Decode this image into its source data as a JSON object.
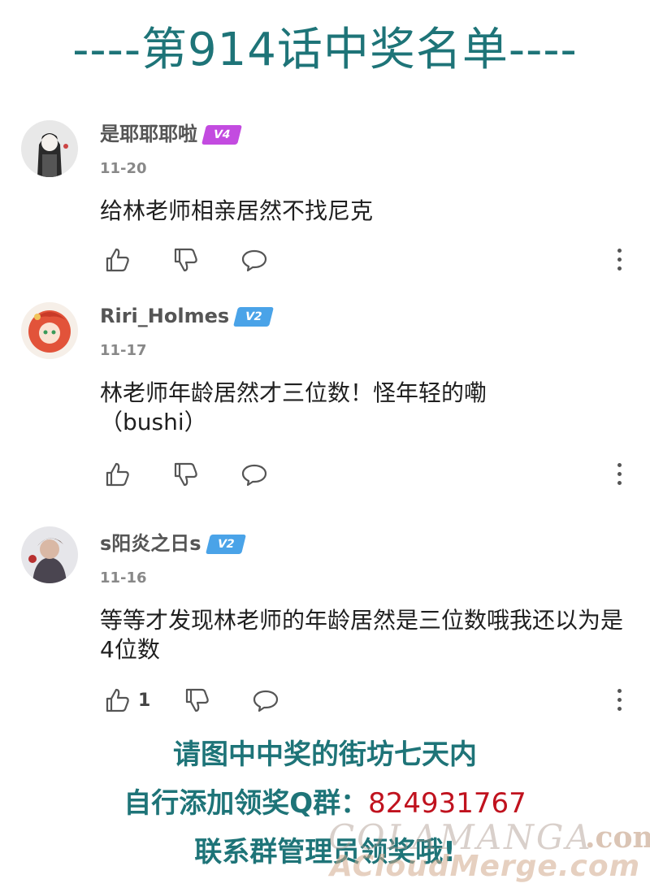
{
  "header": {
    "title": "----第914话中奖名单----"
  },
  "comments": [
    {
      "username": "是耶耶耶啦",
      "badge": "V4",
      "badge_color": "#c34be0",
      "date": "11-20",
      "text": "给林老师相亲居然不找尼克",
      "like_count": ""
    },
    {
      "username": "Riri_Holmes",
      "badge": "V2",
      "badge_color": "#4aa3e8",
      "date": "11-17",
      "text": "林老师年龄居然才三位数！怪年轻的嘞（bushi）",
      "like_count": ""
    },
    {
      "username": "s阳炎之日s",
      "badge": "V2",
      "badge_color": "#4aa3e8",
      "date": "11-16",
      "text": "等等才发现林老师的年龄居然是三位数哦我还以为是4位数",
      "like_count": "1"
    }
  ],
  "icons": {
    "like": "thumbs-up-icon",
    "dislike": "thumbs-down-icon",
    "reply": "comment-bubble-icon",
    "more": "more-vertical-icon"
  },
  "footer": {
    "line1": "请图中中奖的街坊七天内",
    "line2_prefix": "自行添加领奖Q群：",
    "qq_number": "824931767",
    "line3": "联系群管理员领奖哦!"
  },
  "watermark": {
    "text1": "COLAMANGA",
    "text2": ".com",
    "text3": "ACloudMerge.com"
  },
  "colors": {
    "accent": "#1e7478",
    "qq_number": "#c0121e"
  }
}
